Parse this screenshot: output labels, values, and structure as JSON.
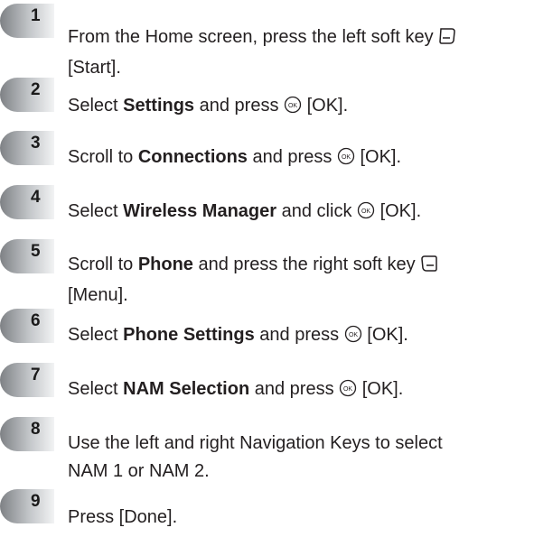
{
  "steps": [
    {
      "number": "1",
      "parts": {
        "a": "From the Home screen, press the left soft key",
        "icon": "left-soft-key-icon",
        "b": "[Start]."
      }
    },
    {
      "number": "2",
      "parts": {
        "a": "Select",
        "bold": "Settings",
        "b": "and press",
        "icon": "ok-key-icon",
        "c": "[OK]."
      }
    },
    {
      "number": "3",
      "parts": {
        "a": "Scroll to",
        "bold": "Connections",
        "b": "and press",
        "icon": "ok-key-icon",
        "c": "[OK]."
      }
    },
    {
      "number": "4",
      "parts": {
        "a": "Select",
        "bold": "Wireless Manager",
        "b": "and click",
        "icon": "ok-key-icon",
        "c": "[OK]."
      }
    },
    {
      "number": "5",
      "parts": {
        "a": "Scroll to",
        "bold": "Phone",
        "b": "and press the right soft key",
        "icon": "right-soft-key-icon",
        "c": "[Menu]."
      }
    },
    {
      "number": "6",
      "parts": {
        "a": "Select",
        "bold": "Phone Settings",
        "b": "and press",
        "icon": "ok-key-icon",
        "c": "[OK]."
      }
    },
    {
      "number": "7",
      "parts": {
        "a": "Select",
        "bold": "NAM Selection",
        "b": "and press",
        "icon": "ok-key-icon",
        "c": "[OK]."
      }
    },
    {
      "number": "8",
      "parts": {
        "a": "Use the left and right Navigation Keys to select NAM 1 or NAM 2."
      }
    },
    {
      "number": "9",
      "parts": {
        "a": "Press [Done]."
      }
    }
  ],
  "colors": {
    "badge_gradient_dark": "#8a8d91",
    "badge_gradient_light": "#eceef0",
    "text": "#231f20"
  }
}
